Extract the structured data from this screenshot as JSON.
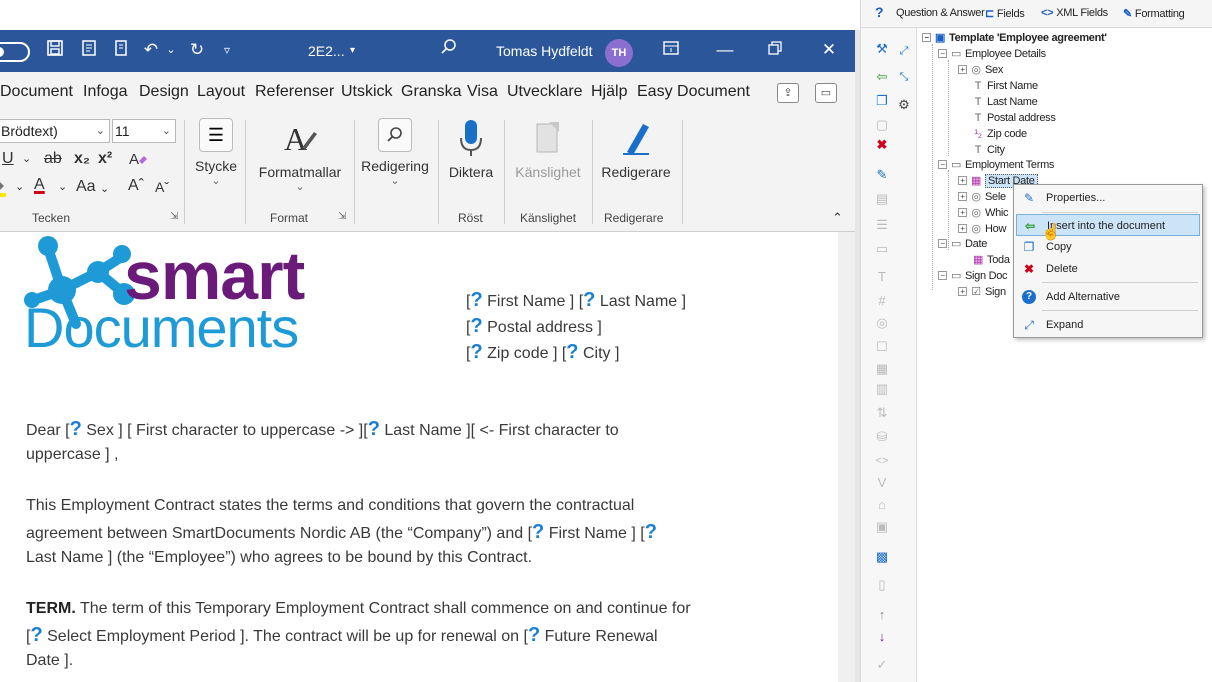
{
  "titlebar": {
    "doc_name": "2E2...",
    "doc_caret": "▾",
    "user_name": "Tomas Hydfeldt",
    "avatar_initials": "TH"
  },
  "menu": {
    "tabs": [
      "Document",
      "Infoga",
      "Design",
      "Layout",
      "Referenser",
      "Utskick",
      "Granska",
      "Visa",
      "Utvecklare",
      "Hjälp",
      "Easy Document C"
    ]
  },
  "ribbon": {
    "font_name": "Brödtext)",
    "font_size": "11",
    "group_tecken": "Tecken",
    "group_format": "Format",
    "group_rost": "Röst",
    "group_kanslighet": "Känslighet",
    "group_redigerare": "Redigerare",
    "stycke": "Stycke",
    "formatmallar": "Formatmallar",
    "redigering": "Redigering",
    "diktera": "Diktera",
    "kanslighet": "Känslighet",
    "redigerare": "Redigerare",
    "fmt_u": "U",
    "fmt_strike": "ab",
    "fmt_sub": "x₂",
    "fmt_sup": "x²",
    "fmt_a": "A",
    "fmt_aa": "Aa",
    "fmt_grow": "Aˆ",
    "fmt_shrink": "Aˇ"
  },
  "document": {
    "logo_top": "smart",
    "logo_bottom": "Documents",
    "addr1_a": "First Name ] [",
    "addr1_b": "Last Name ]",
    "addr2": "Postal address ]",
    "addr3_a": "Zip code ] [",
    "addr3_b": "City ]",
    "bracket_open": "[",
    "qmark": "?",
    "dear_prefix": "Dear [",
    "dear_sex": "Sex ] [  First character to uppercase -> ][",
    "dear_last": "Last Name ][  <- First character to",
    "dear_line2": "uppercase ] ,",
    "p1_line1": "This Employment Contract states the terms and conditions that govern the contractual",
    "p1_line2_a": "agreement between SmartDocuments Nordic AB (the “Company”) and [",
    "p1_line2_b": "First Name ] [",
    "p1_line3": "Last Name ] (the “Employee”) who agrees to be bound by this Contract.",
    "term_bold": "TERM.",
    "term_line1": " The term of this Temporary Employment Contract shall commence on and continue for",
    "term_line2_a": "Select Employment Period ]. The contract will be up for renewal on [",
    "term_line2_b": "Future Renewal",
    "term_line3": "Date ]."
  },
  "pane": {
    "tabs": [
      "Question & Answer",
      "Fields",
      "XML Fields",
      "Formatting"
    ],
    "help_icon": "?",
    "tree": {
      "root": "Template 'Employee agreement'",
      "employee_details": "Employee Details",
      "sex": "Sex",
      "first_name": "First Name",
      "last_name": "Last Name",
      "postal_address": "Postal address",
      "zip_code": "Zip code",
      "city": "City",
      "employment_terms": "Employment Terms",
      "start_date": "Start Date",
      "sele": "Sele",
      "whic": "Whic",
      "how": "How",
      "date": "Date",
      "toda": "Toda",
      "sign_doc": "Sign Doc",
      "sign": "Sign"
    },
    "context_menu": {
      "properties": "Properties...",
      "insert": "Insert into the document",
      "copy": "Copy",
      "delete": "Delete",
      "add_alternative": "Add Alternative",
      "expand": "Expand"
    }
  },
  "colors": {
    "word_blue": "#2b579a",
    "field_blue": "#1a7fd4",
    "logo_purple": "#6a1b7a",
    "logo_blue": "#1e9ad6"
  }
}
